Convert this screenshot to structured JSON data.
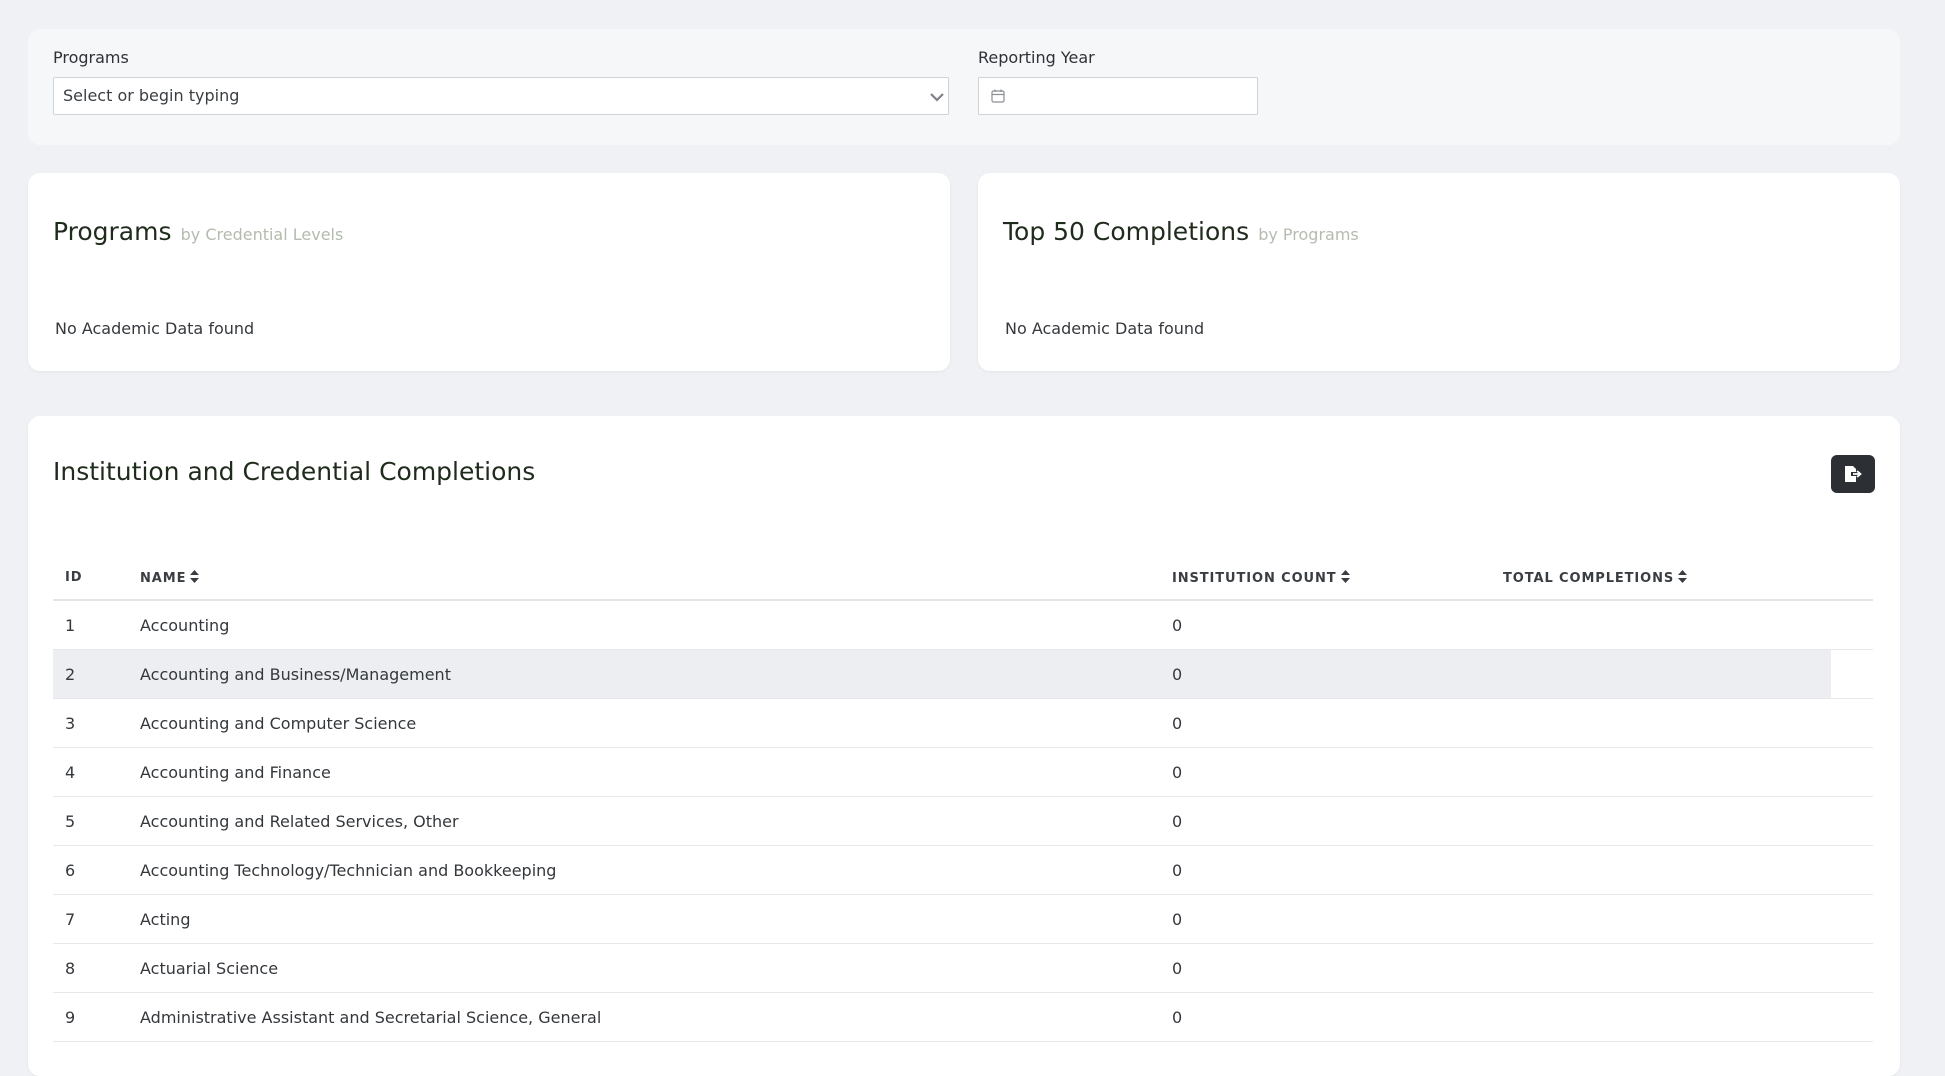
{
  "filters": {
    "programs_label": "Programs",
    "programs_placeholder": "Select or begin typing",
    "year_label": "Reporting Year",
    "year_value": ""
  },
  "cards": {
    "programs": {
      "title": "Programs",
      "subtitle": "by Credential Levels",
      "empty": "No Academic Data found"
    },
    "top50": {
      "title": "Top 50 Completions",
      "subtitle": "by Programs",
      "empty": "No Academic Data found"
    }
  },
  "table": {
    "title": "Institution and Credential Completions",
    "columns": {
      "id": "ID",
      "name": "NAME",
      "count": "INSTITUTION COUNT",
      "total": "TOTAL COMPLETIONS"
    },
    "rows": [
      {
        "id": "1",
        "name": "Accounting",
        "count": "0",
        "total": ""
      },
      {
        "id": "2",
        "name": "Accounting and Business/Management",
        "count": "0",
        "total": ""
      },
      {
        "id": "3",
        "name": "Accounting and Computer Science",
        "count": "0",
        "total": ""
      },
      {
        "id": "4",
        "name": "Accounting and Finance",
        "count": "0",
        "total": ""
      },
      {
        "id": "5",
        "name": "Accounting and Related Services, Other",
        "count": "0",
        "total": ""
      },
      {
        "id": "6",
        "name": "Accounting Technology/Technician and Bookkeeping",
        "count": "0",
        "total": ""
      },
      {
        "id": "7",
        "name": "Acting",
        "count": "0",
        "total": ""
      },
      {
        "id": "8",
        "name": "Actuarial Science",
        "count": "0",
        "total": ""
      },
      {
        "id": "9",
        "name": "Administrative Assistant and Secretarial Science, General",
        "count": "0",
        "total": ""
      }
    ],
    "highlighted_row": 2
  },
  "icons": {
    "programs_dropdown": "chevron-down-icon",
    "year_picker": "calendar-icon",
    "export": "file-export-icon",
    "sort": "sort-icon"
  }
}
